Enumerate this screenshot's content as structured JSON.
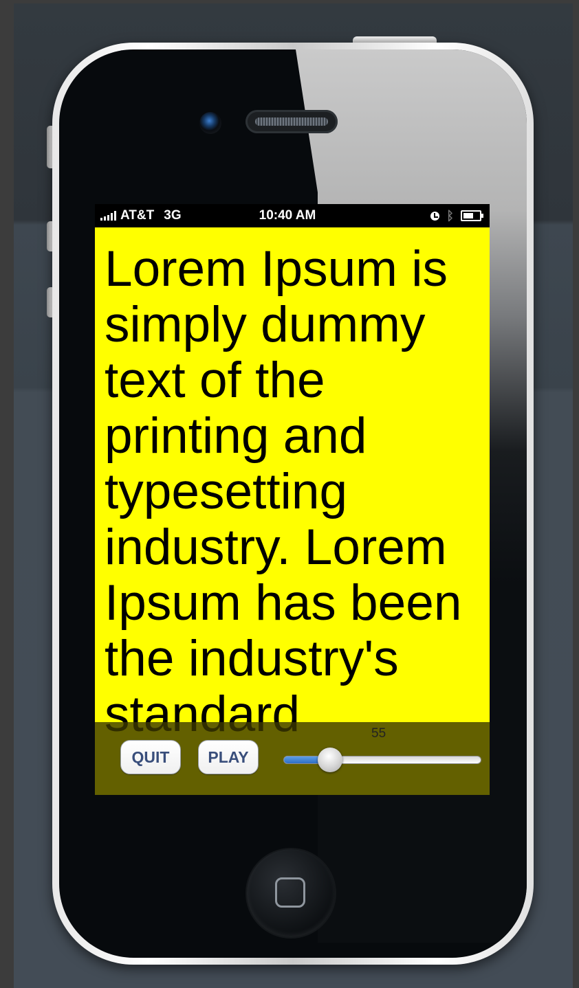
{
  "statusbar": {
    "carrier": "AT&T",
    "network": "3G",
    "time": "10:40 AM"
  },
  "screen": {
    "background_color": "#ffff00",
    "text": "Lorem Ipsum is simply dummy text of the printing and typesetting industry. Lorem Ipsum has been the industry's standard"
  },
  "controls": {
    "quit_label": "QUIT",
    "play_label": "PLAY",
    "slider_value": "55",
    "slider_fill_fraction": 0.22
  },
  "icons": [
    "signal-icon",
    "lock-rotation-icon",
    "bluetooth-icon",
    "battery-icon",
    "camera-icon",
    "speaker-icon",
    "home-button-icon"
  ]
}
